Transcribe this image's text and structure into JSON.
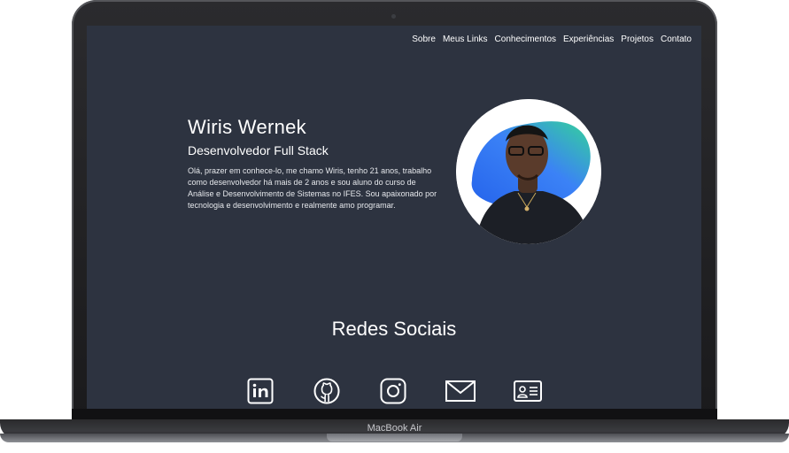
{
  "nav": {
    "items": [
      "Sobre",
      "Meus Links",
      "Conhecimentos",
      "Experiências",
      "Projetos",
      "Contato"
    ]
  },
  "hero": {
    "name": "Wiris Wernek",
    "role": "Desenvolvedor Full Stack",
    "bio": "Olá, prazer em conhece-lo, me chamo Wiris, tenho 21 anos, trabalho como desenvolvedor há mais de 2 anos e sou aluno do curso de Análise e Desenvolvimento de Sistemas no IFES. Sou apaixonado por tecnologia e desenvolvimento e realmente amo programar."
  },
  "social": {
    "title": "Redes Sociais",
    "icons": [
      "linkedin-icon",
      "github-icon",
      "instagram-icon",
      "email-icon",
      "contact-card-icon"
    ]
  },
  "device": {
    "label": "MacBook Air"
  },
  "colors": {
    "page_background": "#2d3340",
    "text": "#ffffff",
    "avatar_blob_start": "#2563eb",
    "avatar_blob_end": "#34d399"
  }
}
